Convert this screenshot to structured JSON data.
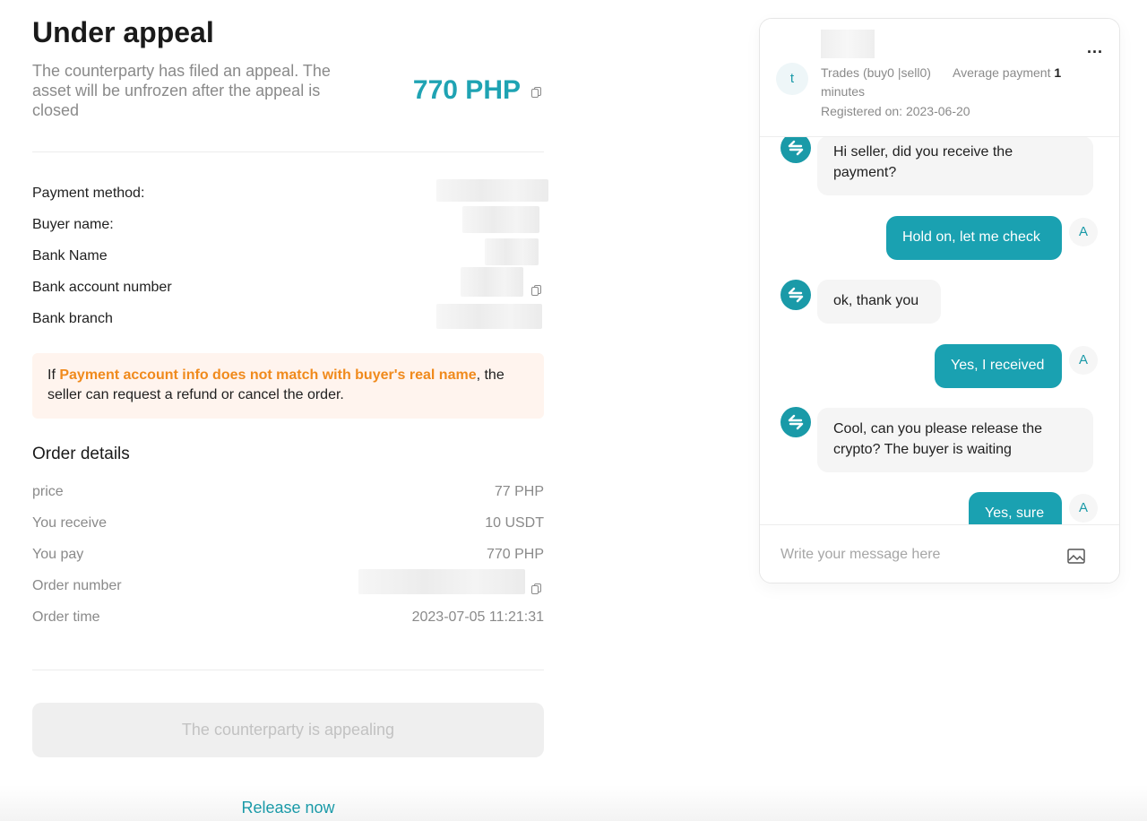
{
  "header": {
    "title": "Under appeal",
    "subtitle": "The counterparty has filed an appeal. The asset will be unfrozen after the appeal is closed",
    "amount": "770 PHP"
  },
  "payment": {
    "method_label": "Payment method:",
    "buyer_label": "Buyer name:",
    "bank_label": "Bank Name",
    "account_label": "Bank account number",
    "branch_label": "Bank branch"
  },
  "notice": {
    "prefix": "If ",
    "highlight": "Payment account info does not match with buyer's real name",
    "suffix": ", the seller can request a refund or cancel the order.",
    "highlight_color": "#f08a1c"
  },
  "order": {
    "title": "Order details",
    "rows": [
      {
        "label": "price",
        "value": "77 PHP"
      },
      {
        "label": "You receive",
        "value": "10 USDT"
      },
      {
        "label": "You pay",
        "value": "770 PHP"
      },
      {
        "label": "Order number",
        "value": ""
      },
      {
        "label": "Order time",
        "value": "2023-07-05 11:21:31"
      }
    ]
  },
  "actions": {
    "appeal_status": "The counterparty is appealing",
    "release": "Release now"
  },
  "chat": {
    "avatar_letter": "t",
    "trades": "Trades (buy0 |sell0)",
    "avg_label": "Average payment",
    "avg_value": "1",
    "avg_unit": "minutes",
    "registered": "Registered on: 2023-06-20",
    "more": "...",
    "user_letter": "A",
    "messages": [
      {
        "from": "them",
        "text": "Hi seller, did you receive the payment?"
      },
      {
        "from": "me",
        "text": "Hold on, let me check"
      },
      {
        "from": "them",
        "text": "ok, thank you"
      },
      {
        "from": "me",
        "text": "Yes, I received"
      },
      {
        "from": "them",
        "text": "Cool, can you please release the crypto? The buyer is waiting"
      },
      {
        "from": "me",
        "text": "Yes, sure"
      }
    ],
    "placeholder": "Write your message here"
  },
  "colors": {
    "accent": "#1aa1b1",
    "amount": "#1fa3b3",
    "notice_bg": "#fff4ee"
  }
}
